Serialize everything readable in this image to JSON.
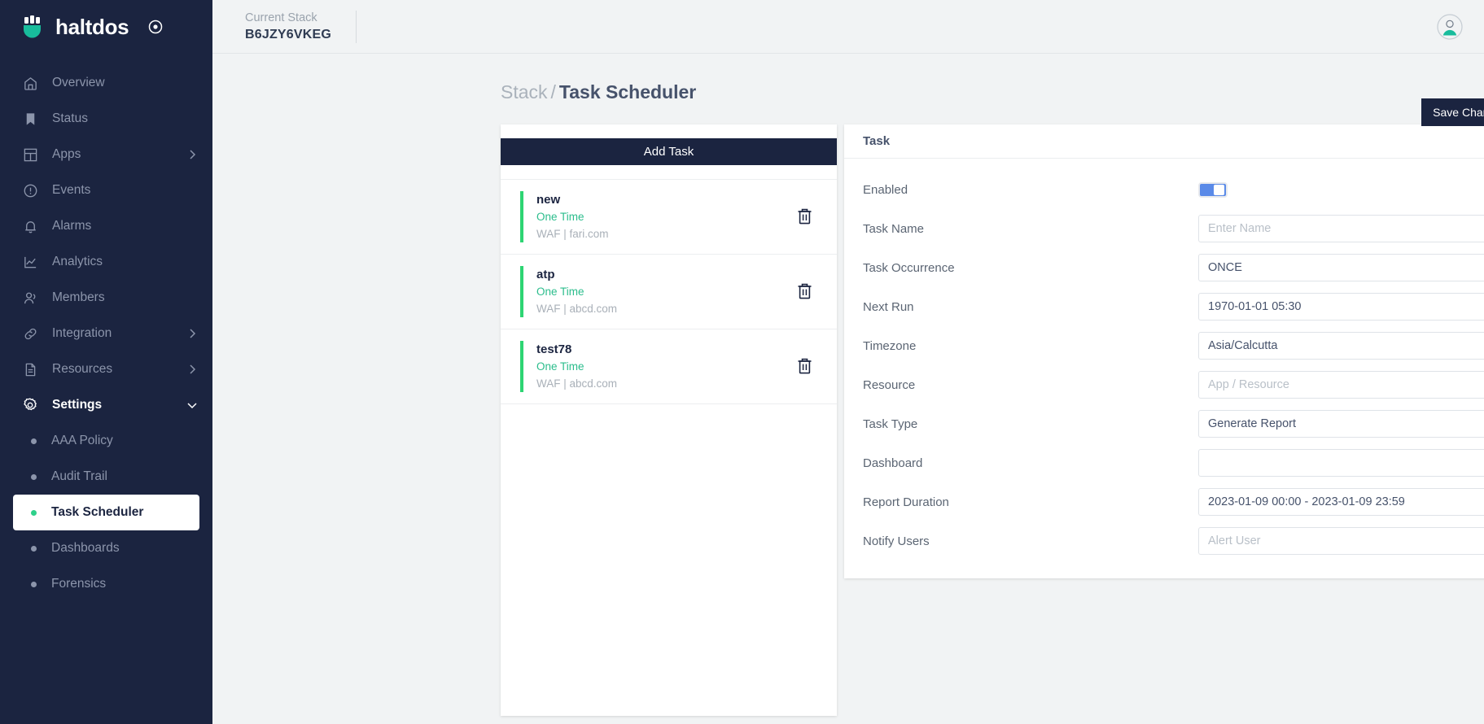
{
  "brand": {
    "name": "haltdos",
    "logo_icon": "haltdos-logo-icon",
    "target_icon": "target-icon"
  },
  "sidebar": {
    "items": [
      {
        "label": "Overview",
        "icon": "home-icon",
        "expandable": false
      },
      {
        "label": "Status",
        "icon": "bookmark-icon",
        "expandable": false
      },
      {
        "label": "Apps",
        "icon": "layout-icon",
        "expandable": true
      },
      {
        "label": "Events",
        "icon": "alert-circle-icon",
        "expandable": false
      },
      {
        "label": "Alarms",
        "icon": "bell-icon",
        "expandable": false
      },
      {
        "label": "Analytics",
        "icon": "chart-line-icon",
        "expandable": false
      },
      {
        "label": "Members",
        "icon": "users-icon",
        "expandable": false
      },
      {
        "label": "Integration",
        "icon": "link-icon",
        "expandable": true
      },
      {
        "label": "Resources",
        "icon": "file-text-icon",
        "expandable": true
      },
      {
        "label": "Settings",
        "icon": "gear-icon",
        "expandable": true,
        "expanded": true
      }
    ],
    "settings_submenu": [
      {
        "label": "AAA Policy",
        "active": false
      },
      {
        "label": "Audit Trail",
        "active": false
      },
      {
        "label": "Task Scheduler",
        "active": true
      },
      {
        "label": "Dashboards",
        "active": false
      },
      {
        "label": "Forensics",
        "active": false
      }
    ]
  },
  "topbar": {
    "stack_label": "Current Stack",
    "stack_value": "B6JZY6VKEG",
    "avatar_icon": "user-avatar-icon"
  },
  "breadcrumb": {
    "parent": "Stack",
    "separator": "/",
    "current": "Task Scheduler"
  },
  "task_list": {
    "add_button": "Add Task",
    "delete_icon": "trash-icon",
    "tasks": [
      {
        "name": "new",
        "occurrence": "One Time",
        "meta": "WAF | fari.com"
      },
      {
        "name": "atp",
        "occurrence": "One Time",
        "meta": "WAF | abcd.com"
      },
      {
        "name": "test78",
        "occurrence": "One Time",
        "meta": "WAF | abcd.com"
      }
    ]
  },
  "save_button": "Save Changes",
  "task_form": {
    "header": "Task",
    "fields": {
      "enabled": {
        "label": "Enabled",
        "type": "toggle",
        "value": "on"
      },
      "task_name": {
        "label": "Task Name",
        "type": "input",
        "value": "",
        "placeholder": "Enter Name"
      },
      "task_occurrence": {
        "label": "Task Occurrence",
        "type": "select",
        "value": "ONCE"
      },
      "next_run": {
        "label": "Next Run",
        "type": "input",
        "value": "1970-01-01 05:30"
      },
      "timezone": {
        "label": "Timezone",
        "type": "select",
        "value": "Asia/Calcutta"
      },
      "resource": {
        "label": "Resource",
        "type": "select",
        "value": "",
        "placeholder": "App / Resource"
      },
      "task_type": {
        "label": "Task Type",
        "type": "select",
        "value": "Generate Report"
      },
      "dashboard": {
        "label": "Dashboard",
        "type": "select",
        "value": ""
      },
      "report_duration": {
        "label": "Report Duration",
        "type": "input",
        "value": "2023-01-09 00:00 - 2023-01-09 23:59"
      },
      "notify_users": {
        "label": "Notify Users",
        "type": "input",
        "value": "",
        "placeholder": "Alert User"
      }
    },
    "chevron_icon": "chevron-down-icon"
  },
  "colors": {
    "sidebar_bg": "#1b2440",
    "brand_teal": "#18bc9c",
    "accent_green": "#2ed573",
    "toggle_blue": "#5a8ae8",
    "occurrence_green": "#2bbd8c"
  }
}
